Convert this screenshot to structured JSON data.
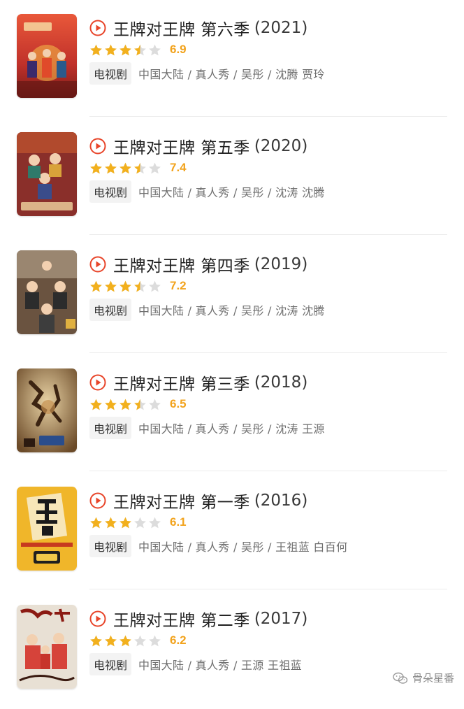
{
  "colors": {
    "accent_red": "#e8452a",
    "star_gold": "#f2b01d",
    "star_empty": "#dcdcdc",
    "score_color": "#f2a31d"
  },
  "icons": {
    "play": "play-circle-icon",
    "star_full": "star-full-icon",
    "star_half": "star-half-icon",
    "star_empty": "star-empty-icon",
    "watermark": "wechat-icon"
  },
  "items": [
    {
      "title": "王牌对王牌 第六季",
      "year": "(2021)",
      "stars": 3.5,
      "score": "6.9",
      "tag": "电视剧",
      "meta": "中国大陆 / 真人秀 / 吴彤 / 沈腾 贾玲",
      "poster_color": "#c0312a"
    },
    {
      "title": "王牌对王牌 第五季",
      "year": "(2020)",
      "stars": 3.5,
      "score": "7.4",
      "tag": "电视剧",
      "meta": "中国大陆 / 真人秀 / 吴彤 / 沈涛 沈腾",
      "poster_color": "#8a2f2a"
    },
    {
      "title": "王牌对王牌 第四季",
      "year": "(2019)",
      "stars": 3.5,
      "score": "7.2",
      "tag": "电视剧",
      "meta": "中国大陆 / 真人秀 / 吴彤 / 沈涛 沈腾",
      "poster_color": "#5a4332"
    },
    {
      "title": "王牌对王牌 第三季",
      "year": "(2018)",
      "stars": 3.5,
      "score": "6.5",
      "tag": "电视剧",
      "meta": "中国大陆 / 真人秀 / 吴彤 / 沈涛 王源",
      "poster_color": "#8b6a3c"
    },
    {
      "title": "王牌对王牌 第一季",
      "year": "(2016)",
      "stars": 3,
      "score": "6.1",
      "tag": "电视剧",
      "meta": "中国大陆 / 真人秀 / 吴彤 / 王祖蓝 白百何",
      "poster_color": "#f0b62a"
    },
    {
      "title": "王牌对王牌 第二季",
      "year": "(2017)",
      "stars": 3,
      "score": "6.2",
      "tag": "电视剧",
      "meta": "中国大陆 / 真人秀 / 王源 王祖蓝",
      "poster_color": "#d6433a"
    }
  ],
  "watermark": {
    "text": "骨朵星番"
  }
}
